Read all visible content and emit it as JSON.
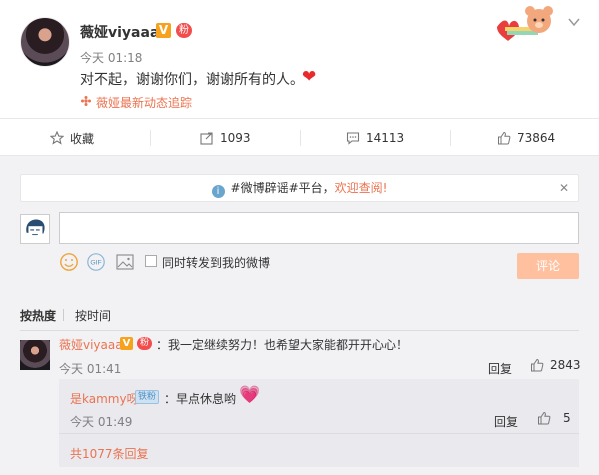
{
  "post": {
    "author": "薇娅viyaaa",
    "v_badge": "V",
    "fan_badge": "粉",
    "time": "今天 01:18",
    "content": "对不起，谢谢你们，谢谢所有的人。",
    "trace_link": "薇娅最新动态追踪"
  },
  "actions": {
    "favorite_label": "收藏",
    "repost_count": "1093",
    "comment_count": "14113",
    "like_count": "73864"
  },
  "notice": {
    "prefix": "#微博辟谣#平台，",
    "link": "欢迎查阅!",
    "close": "✕"
  },
  "composer": {
    "placeholder": "",
    "repost_label": "同时转发到我的微博",
    "submit": "评论",
    "gif_label": "GIF"
  },
  "sort": {
    "hot": "按热度",
    "time": "按时间"
  },
  "comment": {
    "author": "薇娅viyaaa",
    "v_badge": "V",
    "fan_badge": "粉",
    "text": "：我一定继续努力！也希望大家能都开开心心！",
    "time": "今天 01:41",
    "reply": "回复",
    "likes": "2843"
  },
  "subreply": {
    "author": "是kammy呀",
    "badge": "铁粉",
    "text": "：早点休息哟",
    "time": "今天 01:49",
    "reply": "回复",
    "likes": "5",
    "more": "共1077条回复"
  },
  "colors": {
    "accent": "#eb7350",
    "button": "#ffc09f",
    "background": "#f2f2f5"
  }
}
